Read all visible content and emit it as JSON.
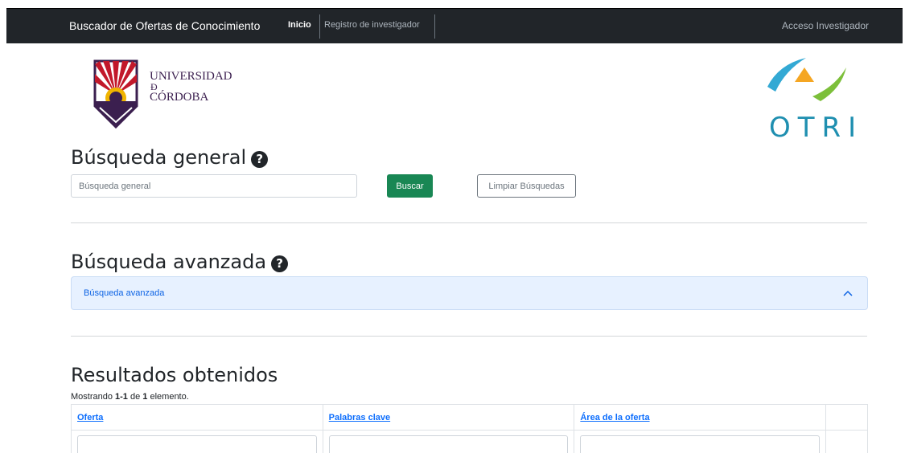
{
  "navbar": {
    "brand": "Buscador de Ofertas de Conocimiento",
    "links": [
      {
        "label": "Inicio",
        "active": true
      },
      {
        "label": "Registro de investigador",
        "active": false
      }
    ],
    "right_link": "Acceso Investigador",
    "bg_color": "#212529"
  },
  "logos": {
    "university": {
      "lines": [
        "UNIVERSIDAD",
        "Ð",
        "CÓRDOBA"
      ]
    },
    "otri": {
      "text": "OTRI"
    }
  },
  "general_search": {
    "heading": "Búsqueda general",
    "help_icon": "question-circle-icon",
    "input_placeholder": "Búsqueda general",
    "input_value": "",
    "search_button": "Buscar",
    "clear_button": "Limpiar Búsquedas",
    "button_color": "#198754"
  },
  "advanced_search": {
    "heading": "Búsqueda avanzada",
    "help_icon": "question-circle-icon",
    "accordion_label": "Búsqueda avanzada",
    "accordion_icon": "chevron-up-icon",
    "accordion_color": "#e7f1ff"
  },
  "results": {
    "heading": "Resultados obtenidos",
    "summary": {
      "prefix": "Mostrando ",
      "range": "1-1",
      "middle": " de ",
      "total": "1",
      "suffix": " elemento."
    },
    "columns": [
      "Oferta",
      "Palabras clave",
      "Área de la oferta",
      ""
    ],
    "link_color": "#0d6efd"
  }
}
